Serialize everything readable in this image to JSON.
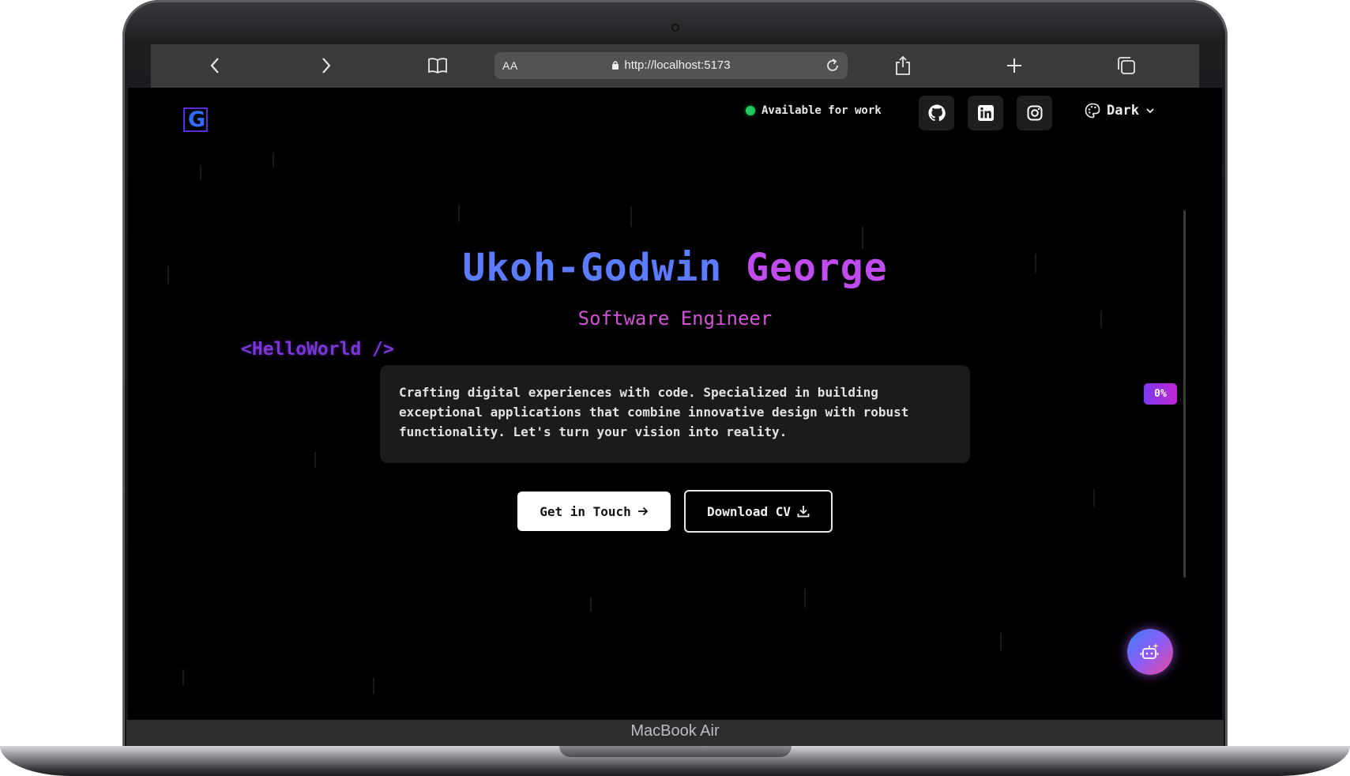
{
  "device": {
    "label": "MacBook Air"
  },
  "browser": {
    "reader_label": "AA",
    "url": "http://localhost:5173",
    "icons": [
      "back-icon",
      "forward-icon",
      "book-icon",
      "lock-icon",
      "reload-icon",
      "share-icon",
      "plus-icon",
      "tabs-icon"
    ]
  },
  "header": {
    "logo_letter": "G",
    "status": "Available for work",
    "status_color": "#22c55e",
    "socials": [
      "github-icon",
      "linkedin-icon",
      "instagram-icon"
    ],
    "theme_label": "Dark"
  },
  "hero": {
    "name_first": "Ukoh-Godwin",
    "name_last": "George",
    "role": "Software Engineer",
    "tag": "<HelloWorld />",
    "intro_lines": [
      "Crafting digital experiences with code. Specialized in building",
      "exceptional applications that combine innovative design with robust",
      "functionality. Let's turn your vision into reality."
    ],
    "cta_primary": "Get in Touch",
    "cta_secondary": "Download CV"
  },
  "scroll": {
    "progress_label": "0%",
    "progress": 0
  },
  "colors": {
    "accent_blue": "#5b7cff",
    "accent_purple": "#c04cf0",
    "accent_pink": "#d452d8"
  }
}
